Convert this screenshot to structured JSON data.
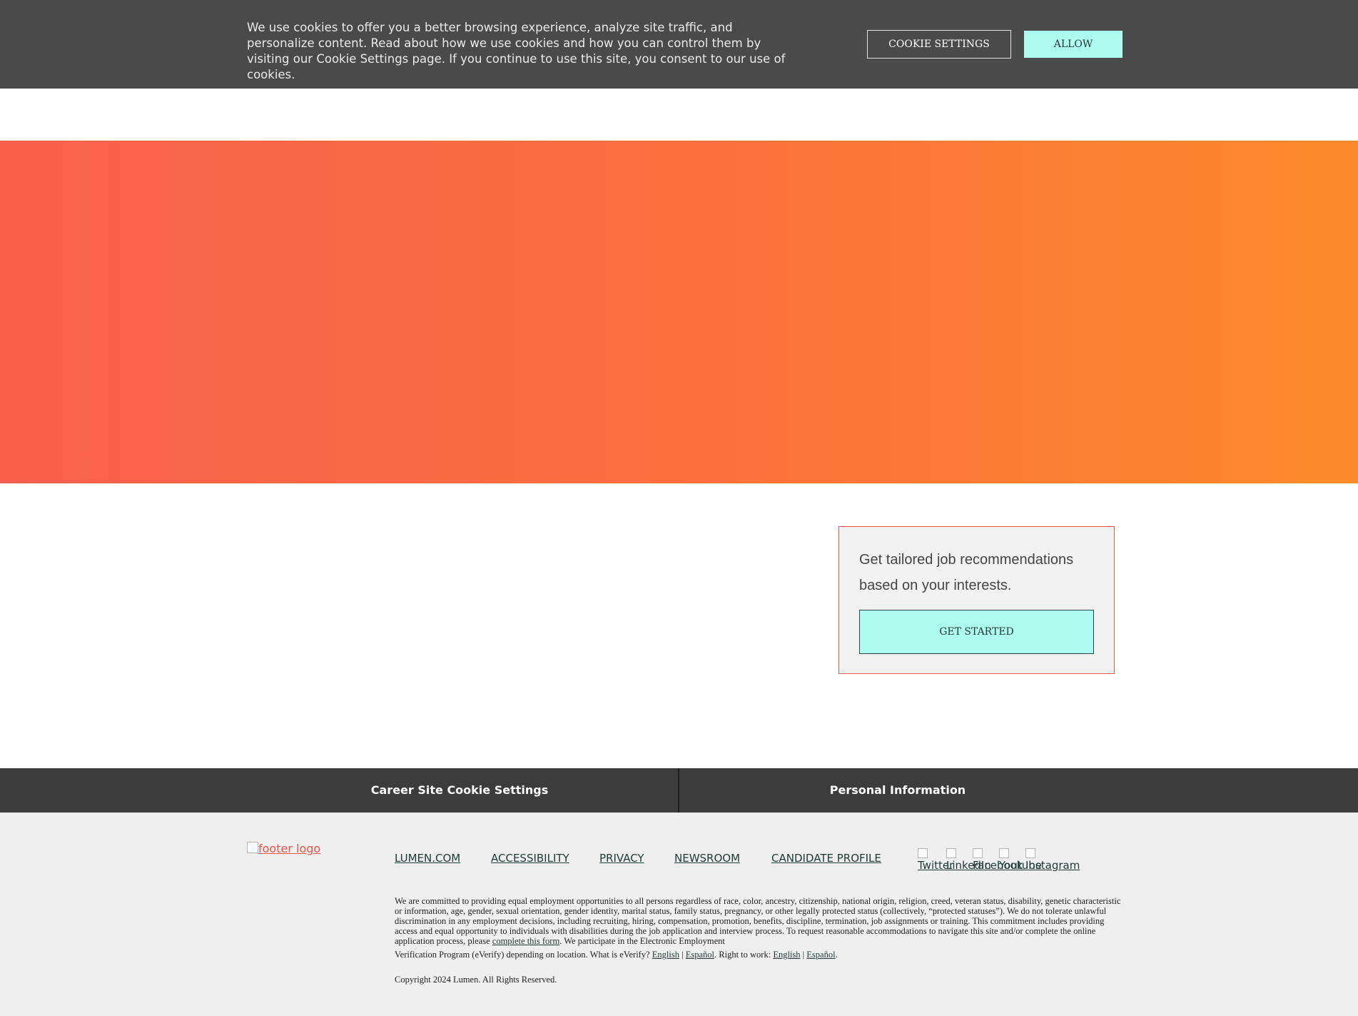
{
  "cookie_banner": {
    "text": "We use cookies to offer you a better browsing experience, analyze site traffic, and personalize content. Read about how we use cookies and how you can control them by visiting our Cookie Settings page. If you continue to use this site, you consent to our use of cookies.",
    "settings_label": "COOKIE SETTINGS",
    "allow_label": "ALLOW"
  },
  "colors": {
    "banner_bg": "#4a4a4a",
    "hero_start": "#f9604d",
    "hero_end": "#fc8a2a",
    "accent_button": "#aefcef",
    "card_border": "#e8564a",
    "footer_bar_bg": "#3c3c3c",
    "footer_bg": "#f0eff0"
  },
  "recommendation_card": {
    "text": "Get tailored job recommendations based on your interests.",
    "button_label": "GET STARTED"
  },
  "footer_bar": {
    "cookie_settings": "Career Site Cookie Settings",
    "personal_information": "Personal Information"
  },
  "footer": {
    "logo_alt": "footer logo",
    "nav": [
      "LUMEN.COM",
      "ACCESSIBILITY",
      "PRIVACY",
      "NEWSROOM",
      "CANDIDATE PROFILE"
    ],
    "social": [
      "Twitter",
      "LinkedIn",
      "Facebook",
      "Youtube",
      "Instagram"
    ],
    "social_icons": [
      "twitter-icon",
      "linkedin-icon",
      "facebook-icon",
      "youtube-icon",
      "instagram-icon"
    ],
    "legal_text": "We are committed to providing equal employment opportunities to all persons regardless of race, color, ancestry, citizenship, national origin, religion, creed, veteran status, disability, genetic characteristic or information, age, gender, sexual orientation, gender identity, marital status, family status, pregnancy, or other legally protected status (collectively, “protected statuses”). We do not tolerate unlawful discrimination in any employment decisions, including recruiting, hiring, compensation, promotion, benefits, discipline, termination, job assignments or training. This commitment includes providing access and equal opportunity to individuals with disabilities during the job application and interview process. To request reasonable accommodations to navigate this site and/or complete the online application process, please",
    "complete_form_link": "complete this form",
    "legal_after_link": ". We participate in the Electronic Employment",
    "verify_text": "Verification Program (eVerify) depending on location. What is eVerify?",
    "everify_english": "English",
    "everify_espanol": "Español",
    "right_to_work": ". Right to work:",
    "rtw_english": "English",
    "rtw_espanol": "Español",
    "separator": "|",
    "period": ".",
    "copyright": "Copyright 2024 Lumen. All Rights Reserved."
  }
}
